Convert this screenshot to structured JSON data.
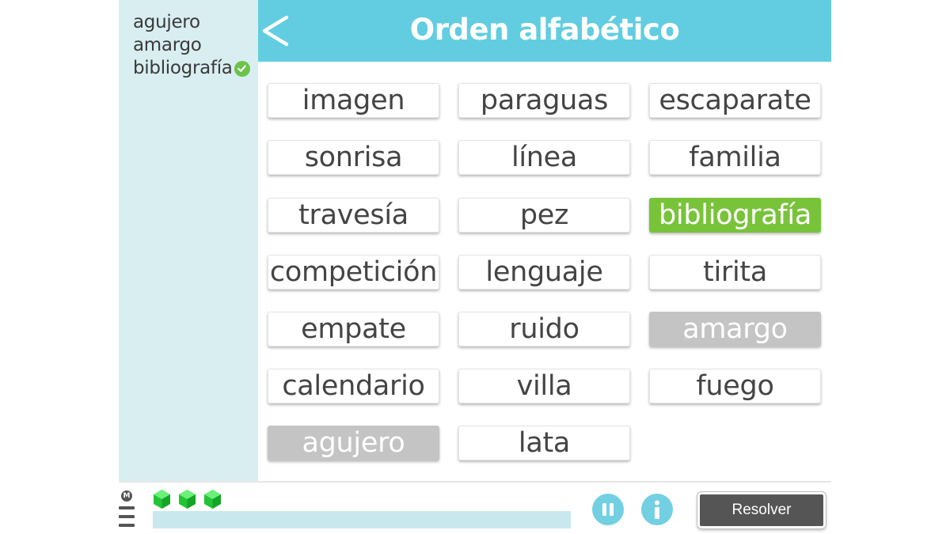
{
  "title": "Orden alfabético",
  "back_label": "<",
  "sidebar": {
    "found_words": [
      {
        "text": "agujero",
        "checked": false
      },
      {
        "text": "amargo",
        "checked": false
      },
      {
        "text": "bibliografía",
        "checked": true
      }
    ]
  },
  "grid": {
    "tiles": [
      {
        "text": "imagen",
        "state": "normal"
      },
      {
        "text": "paraguas",
        "state": "normal"
      },
      {
        "text": "escaparate",
        "state": "normal"
      },
      {
        "text": "sonrisa",
        "state": "normal"
      },
      {
        "text": "línea",
        "state": "normal"
      },
      {
        "text": "familia",
        "state": "normal"
      },
      {
        "text": "travesía",
        "state": "normal"
      },
      {
        "text": "pez",
        "state": "normal"
      },
      {
        "text": "bibliografía",
        "state": "current"
      },
      {
        "text": "competición",
        "state": "normal"
      },
      {
        "text": "lenguaje",
        "state": "normal"
      },
      {
        "text": "tirita",
        "state": "normal"
      },
      {
        "text": "empate",
        "state": "normal"
      },
      {
        "text": "ruido",
        "state": "normal"
      },
      {
        "text": "amargo",
        "state": "done"
      },
      {
        "text": "calendario",
        "state": "normal"
      },
      {
        "text": "villa",
        "state": "normal"
      },
      {
        "text": "fuego",
        "state": "normal"
      },
      {
        "text": "agujero",
        "state": "done"
      },
      {
        "text": "lata",
        "state": "normal"
      }
    ]
  },
  "footer": {
    "menu_badge": "M",
    "gems": 3,
    "progress": 0,
    "resolver_label": "Resolver",
    "pause_icon": "pause-icon",
    "info_icon": "info-icon"
  },
  "colors": {
    "header": "#62cde0",
    "sidebar": "#d9eef1",
    "current_tile": "#79c33a",
    "done_tile": "#c4c4c4",
    "gem": "#2bd43d",
    "resolver": "#555555"
  }
}
